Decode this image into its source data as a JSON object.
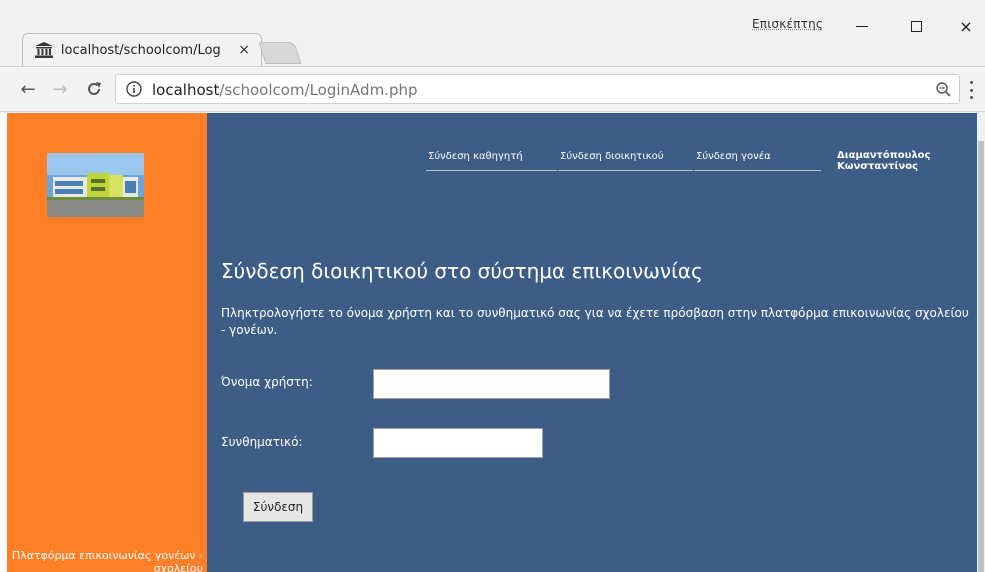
{
  "browser": {
    "tab": {
      "title": "localhost/schoolcom/Log",
      "close": "×",
      "favicon": "bank-building-icon"
    },
    "user_label": "Επισκέπτης",
    "window_controls": {
      "minimize": "minimize-icon",
      "maximize": "maximize-icon",
      "close": "×"
    },
    "nav": {
      "back": "←",
      "forward": "→",
      "reload": "C"
    },
    "address": {
      "host": "localhost",
      "path": "/schoolcom/LoginAdm.php"
    }
  },
  "sidebar": {
    "background": "#ff7f27",
    "footer_text": "Πλατφόρμα επικοινωνίας γονέων - σχολείου"
  },
  "page": {
    "background": "#3d5d87",
    "nav": [
      {
        "label": "Σύνδεση καθηγητή"
      },
      {
        "label": "Σύνδεση διοικητικού"
      },
      {
        "label": "Σύνδεση γονέα"
      }
    ],
    "user_name": "Διαμαντόπουλος Κωνσταντίνος",
    "heading": "Σύνδεση διοικητικού στο σύστημα επικοινωνίας",
    "intro": "Πληκτρολογήστε το όνομα χρήστη και το συνθηματικό σας για να έχετε πρόσβαση στην πλατφόρμα επικοινωνίας σχολείου - γονέων.",
    "form": {
      "username_label": "Όνομα χρήστη:",
      "username_value": "",
      "password_label": "Συνθηματικό:",
      "password_value": "",
      "submit_label": "Σύνδεση"
    }
  }
}
